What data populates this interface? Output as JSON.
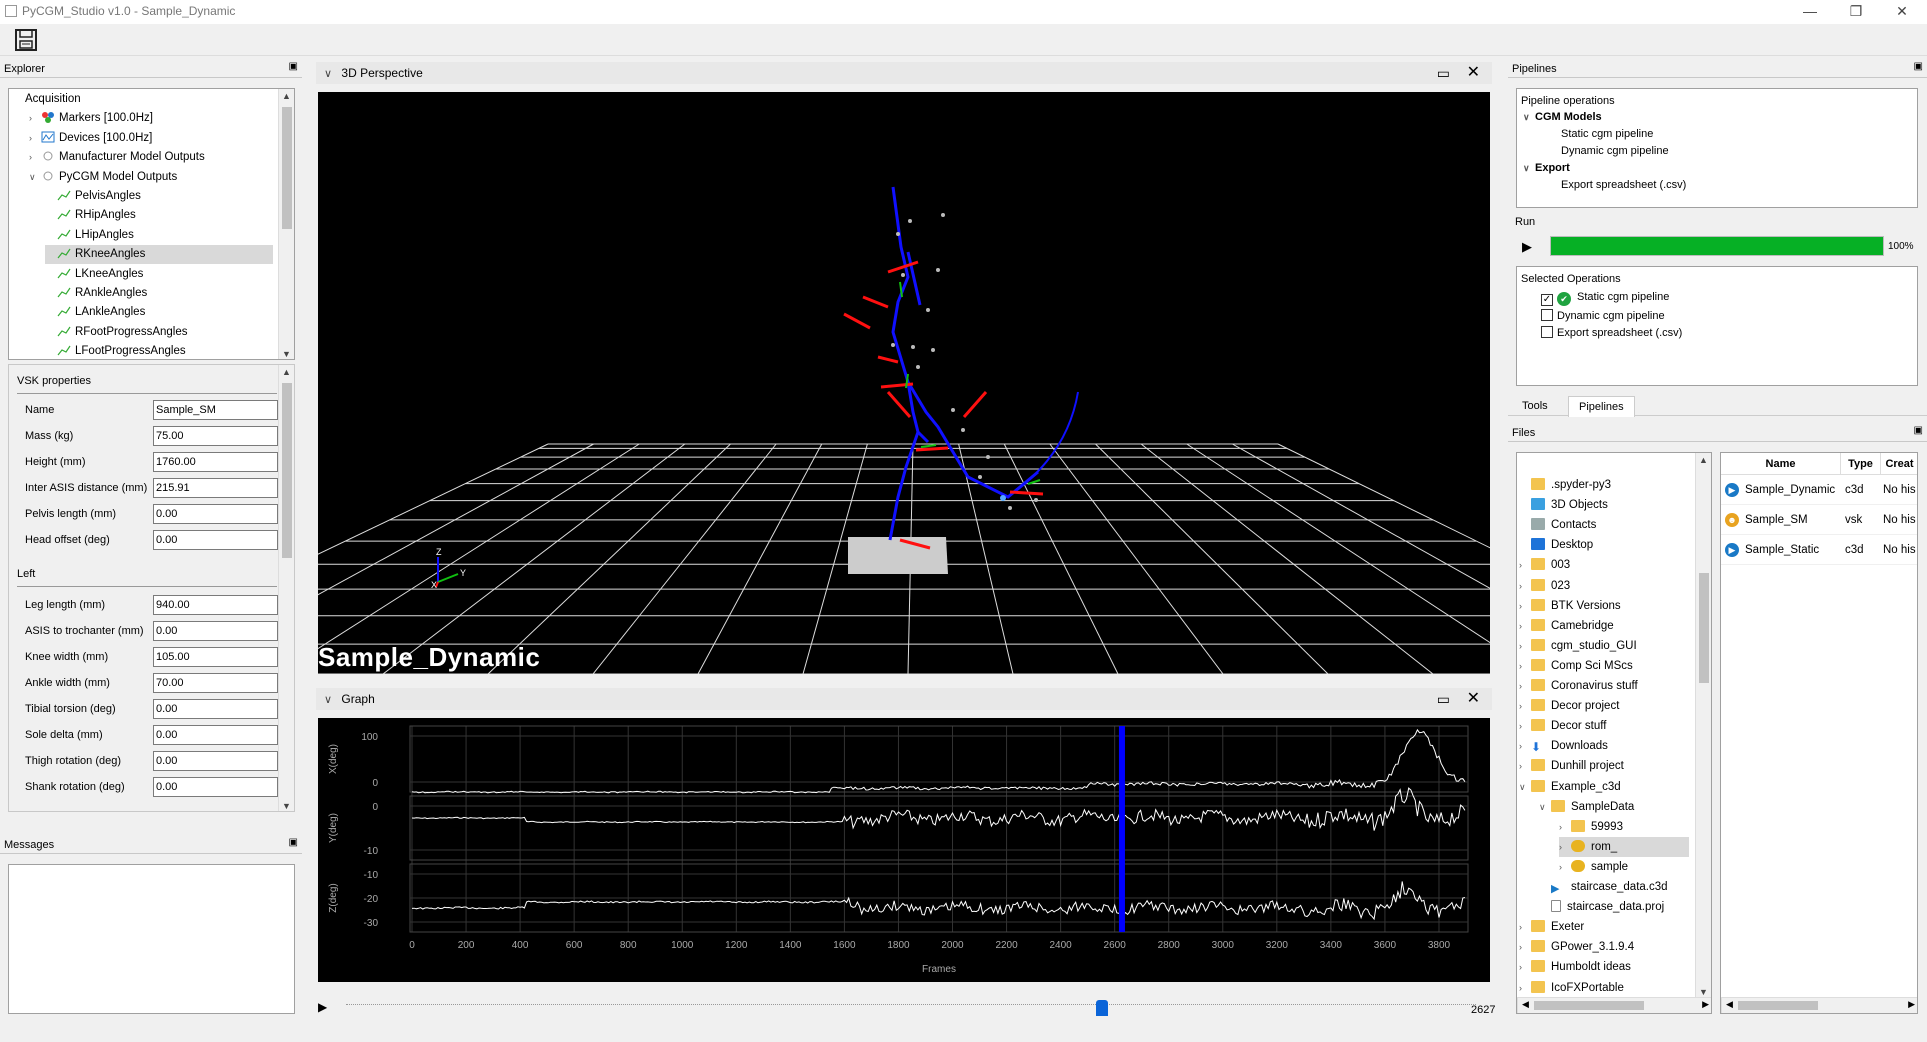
{
  "window": {
    "title": "PyCGM_Studio v1.0 - Sample_Dynamic",
    "controls": [
      "—",
      "❐",
      "✕"
    ]
  },
  "explorer": {
    "title": "Explorer",
    "tree": [
      {
        "label": "Acquisition",
        "level": 0,
        "arrow": "",
        "icon": ""
      },
      {
        "label": "Markers [100.0Hz]",
        "level": 1,
        "arrow": ">",
        "icon": "markers-icon"
      },
      {
        "label": "Devices [100.0Hz]",
        "level": 1,
        "arrow": ">",
        "icon": "devices-icon"
      },
      {
        "label": "Manufacturer Model Outputs",
        "level": 1,
        "arrow": ">",
        "icon": "model-outputs-icon"
      },
      {
        "label": "PyCGM Model Outputs",
        "level": 1,
        "arrow": "v",
        "icon": "model-outputs-icon"
      },
      {
        "label": "PelvisAngles",
        "level": 2,
        "arrow": "",
        "icon": "angle-icon"
      },
      {
        "label": "RHipAngles",
        "level": 2,
        "arrow": "",
        "icon": "angle-icon"
      },
      {
        "label": "LHipAngles",
        "level": 2,
        "arrow": "",
        "icon": "angle-icon"
      },
      {
        "label": "RKneeAngles",
        "level": 2,
        "arrow": "",
        "icon": "angle-icon",
        "selected": true
      },
      {
        "label": "LKneeAngles",
        "level": 2,
        "arrow": "",
        "icon": "angle-icon"
      },
      {
        "label": "RAnkleAngles",
        "level": 2,
        "arrow": "",
        "icon": "angle-icon"
      },
      {
        "label": "LAnkleAngles",
        "level": 2,
        "arrow": "",
        "icon": "angle-icon"
      },
      {
        "label": "RFootProgressAngles",
        "level": 2,
        "arrow": "",
        "icon": "angle-icon"
      },
      {
        "label": "LFootProgressAngles",
        "level": 2,
        "arrow": "",
        "icon": "angle-icon"
      }
    ]
  },
  "vsk": {
    "title": "VSK properties",
    "fields": [
      {
        "label": "Name",
        "value": "Sample_SM"
      },
      {
        "label": "Mass (kg)",
        "value": "75.00"
      },
      {
        "label": "Height (mm)",
        "value": "1760.00"
      },
      {
        "label": "Inter ASIS distance (mm)",
        "value": "215.91"
      },
      {
        "label": "Pelvis length (mm)",
        "value": "0.00"
      },
      {
        "label": "Head offset (deg)",
        "value": "0.00"
      }
    ],
    "left_title": "Left",
    "left_fields": [
      {
        "label": "Leg length (mm)",
        "value": "940.00"
      },
      {
        "label": "ASIS to trochanter (mm)",
        "value": "0.00"
      },
      {
        "label": "Knee width (mm)",
        "value": "105.00"
      },
      {
        "label": "Ankle width (mm)",
        "value": "70.00"
      },
      {
        "label": "Tibial torsion (deg)",
        "value": "0.00"
      },
      {
        "label": "Sole delta (mm)",
        "value": "0.00"
      },
      {
        "label": "Thigh rotation (deg)",
        "value": "0.00"
      },
      {
        "label": "Shank rotation (deg)",
        "value": "0.00"
      }
    ]
  },
  "messages": {
    "title": "Messages"
  },
  "perspective": {
    "title": "3D Perspective",
    "overlay": "Sample_Dynamic",
    "axis_x": "X",
    "axis_y": "Y",
    "axis_z": "Z"
  },
  "graph": {
    "title": "Graph",
    "xlabel": "Frames"
  },
  "chart_data": {
    "type": "line",
    "xlabel": "Frames",
    "xlim": [
      0,
      3900
    ],
    "xticks": [
      0,
      200,
      400,
      600,
      800,
      1000,
      1200,
      1400,
      1600,
      1800,
      2000,
      2200,
      2400,
      2600,
      2800,
      3000,
      3200,
      3400,
      3600,
      3800
    ],
    "current_frame": 2627,
    "subplots": [
      {
        "ylabel": "X(deg)",
        "yticks": [
          "100",
          "0"
        ]
      },
      {
        "ylabel": "Y(deg)",
        "yticks": [
          "0",
          "-10"
        ]
      },
      {
        "ylabel": "Z(deg)",
        "yticks": [
          "-10",
          "-20",
          "-30"
        ]
      }
    ],
    "marker_color": "#0000ff"
  },
  "timeline": {
    "frame": "2627"
  },
  "pipelines": {
    "title": "Pipelines",
    "ops_title": "Pipeline operations",
    "groups": [
      {
        "label": "CGM Models",
        "items": [
          "Static cgm pipeline",
          "Dynamic cgm pipeline"
        ]
      },
      {
        "label": "Export",
        "items": [
          "Export spreadsheet (.csv)"
        ]
      }
    ],
    "run_label": "Run",
    "progress": 1.0,
    "progress_text": "100%",
    "progress_color": "#06b025",
    "selected_title": "Selected Operations",
    "selected": [
      {
        "label": "Static cgm pipeline",
        "checked": true,
        "status": "done"
      },
      {
        "label": "Dynamic cgm pipeline",
        "checked": false
      },
      {
        "label": "Export spreadsheet (.csv)",
        "checked": false
      }
    ],
    "tabs": [
      "Tools",
      "Pipelines"
    ]
  },
  "files": {
    "title": "Files",
    "tree": [
      {
        "label": ".spyder-py3",
        "level": 0,
        "arrow": "",
        "icon": "folder"
      },
      {
        "label": "3D Objects",
        "level": 0,
        "arrow": "",
        "icon": "objects"
      },
      {
        "label": "Contacts",
        "level": 0,
        "arrow": "",
        "icon": "contacts"
      },
      {
        "label": "Desktop",
        "level": 0,
        "arrow": "",
        "icon": "desktop"
      },
      {
        "label": "003",
        "level": 0,
        "arrow": ">",
        "icon": "folder"
      },
      {
        "label": "023",
        "level": 0,
        "arrow": ">",
        "icon": "folder"
      },
      {
        "label": "BTK Versions",
        "level": 0,
        "arrow": ">",
        "icon": "folder"
      },
      {
        "label": "Camebridge",
        "level": 0,
        "arrow": ">",
        "icon": "folder"
      },
      {
        "label": "cgm_studio_GUI",
        "level": 0,
        "arrow": ">",
        "icon": "folder"
      },
      {
        "label": "Comp Sci MScs",
        "level": 0,
        "arrow": ">",
        "icon": "folder"
      },
      {
        "label": "Coronavirus stuff",
        "level": 0,
        "arrow": ">",
        "icon": "folder"
      },
      {
        "label": "Decor project",
        "level": 0,
        "arrow": ">",
        "icon": "folder"
      },
      {
        "label": "Decor stuff",
        "level": 0,
        "arrow": ">",
        "icon": "folder"
      },
      {
        "label": "Downloads",
        "level": 0,
        "arrow": ">",
        "icon": "downloads"
      },
      {
        "label": "Dunhill project",
        "level": 0,
        "arrow": ">",
        "icon": "folder"
      },
      {
        "label": "Example_c3d",
        "level": 0,
        "arrow": "v",
        "icon": "folder"
      },
      {
        "label": "SampleData",
        "level": 1,
        "arrow": "v",
        "icon": "folder"
      },
      {
        "label": "59993",
        "level": 2,
        "arrow": ">",
        "icon": "folder"
      },
      {
        "label": "rom_",
        "level": 2,
        "arrow": ">",
        "icon": "subject",
        "selected": true
      },
      {
        "label": "sample",
        "level": 2,
        "arrow": ">",
        "icon": "subject"
      },
      {
        "label": "staircase_data.c3d",
        "level": 1,
        "arrow": "",
        "icon": "c3d"
      },
      {
        "label": "staircase_data.proj",
        "level": 1,
        "arrow": "",
        "icon": "file"
      },
      {
        "label": "Exeter",
        "level": 0,
        "arrow": ">",
        "icon": "folder"
      },
      {
        "label": "GPower_3.1.9.4",
        "level": 0,
        "arrow": ">",
        "icon": "folder"
      },
      {
        "label": "Humboldt ideas",
        "level": 0,
        "arrow": ">",
        "icon": "folder"
      },
      {
        "label": "IcoFXPortable",
        "level": 0,
        "arrow": ">",
        "icon": "folder"
      }
    ],
    "columns": [
      "Name",
      "Type",
      "Creat"
    ],
    "rows": [
      {
        "name": "Sample_Dynamic",
        "type": "c3d",
        "created": "No his",
        "icon": "c3d"
      },
      {
        "name": "Sample_SM",
        "type": "vsk",
        "created": "No his",
        "icon": "vsk"
      },
      {
        "name": "Sample_Static",
        "type": "c3d",
        "created": "No his",
        "icon": "c3d"
      }
    ]
  }
}
